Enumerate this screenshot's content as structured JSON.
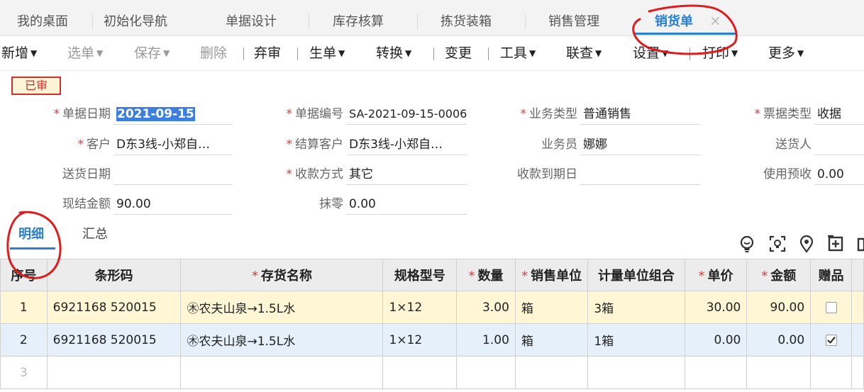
{
  "tabs": [
    {
      "label": "我的桌面"
    },
    {
      "label": "初始化导航"
    },
    {
      "label": "单据设计"
    },
    {
      "label": "库存核算"
    },
    {
      "label": "拣货装箱"
    },
    {
      "label": "销售管理"
    },
    {
      "label": "销货单",
      "active": true
    }
  ],
  "toolbar": {
    "new": "新增",
    "select": "选单",
    "save": "保存",
    "delete": "删除",
    "abandon": "弃审",
    "generate": "生单",
    "convert": "转换",
    "change": "变更",
    "tools": "工具",
    "linked": "联查",
    "settings": "设置",
    "print": "打印",
    "more": "更多"
  },
  "status": "已审",
  "form": {
    "doc_date_label": "单据日期",
    "doc_date": "2021-09-15",
    "doc_no_label": "单据编号",
    "doc_no": "SA-2021-09-15-0006",
    "biz_type_label": "业务类型",
    "biz_type": "普通销售",
    "invoice_type_label": "票据类型",
    "invoice_type": "收据",
    "customer_label": "客户",
    "customer": "D东3线-小郑自…",
    "settle_customer_label": "结算客户",
    "settle_customer": "D东3线-小郑自…",
    "salesman_label": "业务员",
    "salesman": "娜娜",
    "deliverer_label": "送货人",
    "deliverer": "",
    "delivery_date_label": "送货日期",
    "delivery_date": "",
    "payment_method_label": "收款方式",
    "payment_method": "其它",
    "payment_due_label": "收款到期日",
    "payment_due": "",
    "use_prepaid_label": "使用预收",
    "use_prepaid": "0.00",
    "cash_amount_label": "现结金额",
    "cash_amount": "90.00",
    "round_off_label": "抹零",
    "round_off": "0.00"
  },
  "subtabs": {
    "detail": "明细",
    "summary": "汇总"
  },
  "grid": {
    "headers": {
      "idx": "序号",
      "barcode": "条形码",
      "name": "存货名称",
      "spec": "规格型号",
      "qty": "数量",
      "unit": "销售单位",
      "unit_combo": "计量单位组合",
      "price": "单价",
      "amount": "金额",
      "gift": "赠品"
    },
    "rows": [
      {
        "idx": "1",
        "barcode": "6921168 520015",
        "name": "㊍农夫山泉→1.5L水",
        "spec": "1×12",
        "qty": "3.00",
        "unit": "箱",
        "unit_combo": "3箱",
        "price": "30.00",
        "amount": "90.00",
        "gift": false
      },
      {
        "idx": "2",
        "barcode": "6921168 520015",
        "name": "㊍农夫山泉→1.5L水",
        "spec": "1×12",
        "qty": "1.00",
        "unit": "箱",
        "unit_combo": "1箱",
        "price": "0.00",
        "amount": "0.00",
        "gift": true
      },
      {
        "idx": "3",
        "barcode": "",
        "name": "",
        "spec": "",
        "qty": "",
        "unit": "",
        "unit_combo": "",
        "price": "",
        "amount": "",
        "gift": null
      }
    ]
  },
  "colors": {
    "accent": "#2a7fd0",
    "required": "#e23a3a",
    "annotation": "#e01b1b"
  }
}
